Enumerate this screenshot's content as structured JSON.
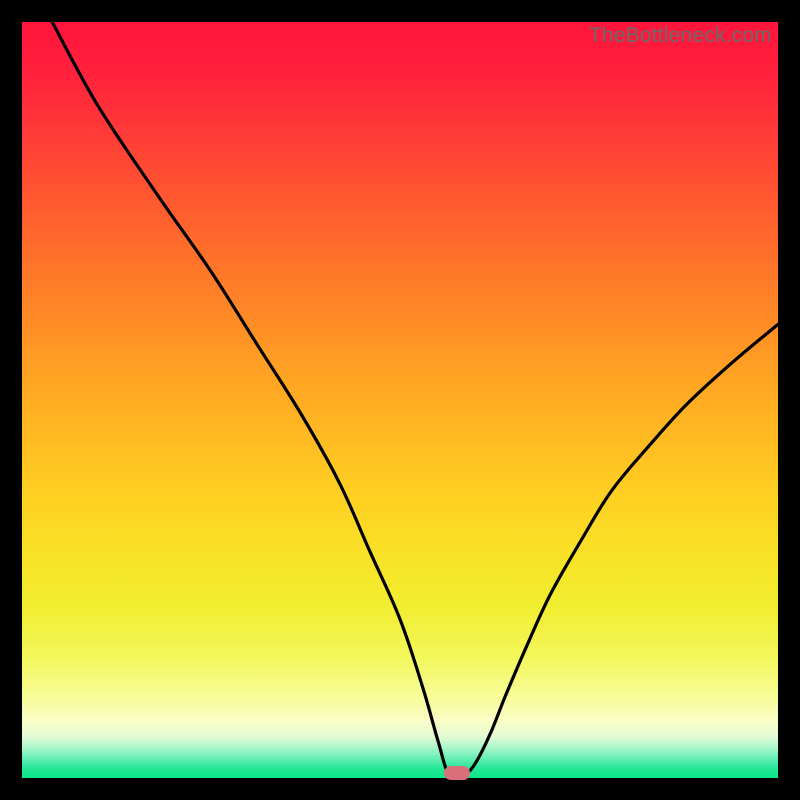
{
  "watermark": "TheBottleneck.com",
  "colors": {
    "frame": "#000000",
    "marker": "#d97079",
    "curve": "#000000"
  },
  "chart_data": {
    "type": "line",
    "title": "",
    "xlabel": "",
    "ylabel": "",
    "xlim": [
      0,
      100
    ],
    "ylim": [
      0,
      100
    ],
    "grid": false,
    "legend": false,
    "annotations": {
      "watermark": "TheBottleneck.com",
      "marker": {
        "x": 57.5,
        "y": 0.6
      }
    },
    "series": [
      {
        "name": "bottleneck-curve",
        "x": [
          4,
          10,
          18,
          25,
          31,
          37,
          42,
          46,
          50,
          53,
          55,
          56.5,
          58.5,
          60,
          62,
          64,
          67,
          70,
          74,
          78,
          83,
          88,
          94,
          100
        ],
        "y": [
          100,
          89,
          77,
          67,
          57.5,
          48,
          39,
          30,
          21,
          12,
          5,
          0.5,
          0.5,
          2,
          6,
          11,
          18,
          24.5,
          31.5,
          38,
          44,
          49.5,
          55,
          60
        ]
      }
    ]
  }
}
